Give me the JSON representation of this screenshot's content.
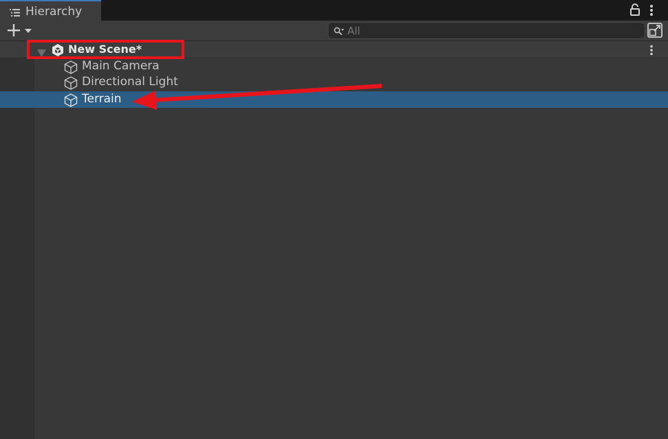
{
  "window": {
    "tab_label": "Hierarchy",
    "tab_icon": "hierarchy-list-icon",
    "lock_icon": "lock-icon",
    "menu_icon": "kebab-menu-icon"
  },
  "toolbar": {
    "add_icon": "plus-dropdown-icon",
    "search": {
      "placeholder": "All",
      "value": ""
    },
    "popout_icon": "scene-popout-icon"
  },
  "scene": {
    "label": "New Scene*",
    "expanded": true,
    "icon": "unity-scene-icon"
  },
  "items": [
    {
      "label": "Main Camera",
      "icon": "gameobject-cube-icon",
      "selected": false
    },
    {
      "label": "Directional Light",
      "icon": "gameobject-cube-icon",
      "selected": false
    },
    {
      "label": "Terrain",
      "icon": "gameobject-cube-icon",
      "selected": true
    }
  ],
  "annotations": {
    "highlight_color": "#e8141b",
    "arrow_color": "#e8141b"
  },
  "colors": {
    "selection": "#2c5d87",
    "panel_bg": "#383838",
    "tab_accent": "#3a79bb"
  }
}
